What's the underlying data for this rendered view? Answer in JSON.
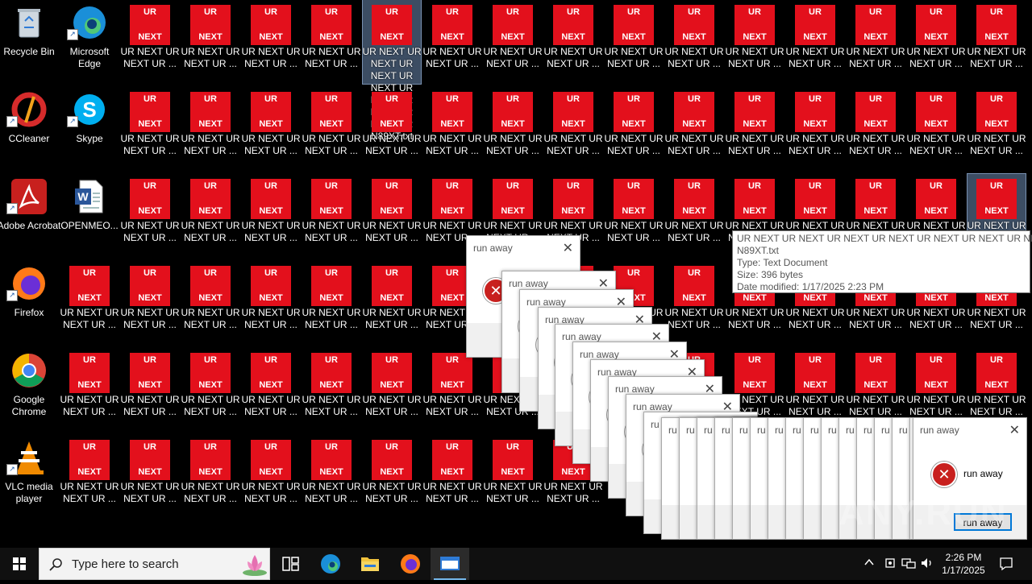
{
  "desktop": {
    "system_icons": [
      {
        "label": "Recycle Bin",
        "icon": "recycle-bin-icon"
      },
      {
        "label": "Microsoft Edge",
        "icon": "edge-icon"
      },
      {
        "label": "CCleaner",
        "icon": "ccleaner-icon"
      },
      {
        "label": "Skype",
        "icon": "skype-icon"
      },
      {
        "label": "Adobe Acrobat",
        "icon": "acrobat-icon"
      },
      {
        "label": "OPENMEO...",
        "icon": "word-doc-icon"
      },
      {
        "label": "Firefox",
        "icon": "firefox-icon"
      },
      {
        "label": "Google Chrome",
        "icon": "chrome-icon"
      },
      {
        "label": "VLC media player",
        "icon": "vlc-icon"
      }
    ],
    "tile_top_text": "UR",
    "tile_bottom_text": "NEXT",
    "file_label_line1": "UR NEXT UR",
    "file_label_line2": "NEXT UR ...",
    "selected_expanded_label": "UR NEXT UR NEXT UR NEXT UR NEXT UR NEXT UR NEXT UR NEXT UR N89XT.txt"
  },
  "tooltip": {
    "name_line1": "UR NEXT UR NEXT UR NEXT UR NEXT UR NEXT UR NEXT UR NEXT UR",
    "name_line2": "N89XT.txt",
    "type": "Type: Text Document",
    "size": "Size: 396 bytes",
    "modified": "Date modified: 1/17/2025 2:23 PM"
  },
  "dialogs": {
    "title": "run away",
    "message": "run away",
    "button": "run away",
    "close_glyph": "✕",
    "stub_title": "ru"
  },
  "taskbar": {
    "search_placeholder": "Type here to search",
    "time": "2:26 PM",
    "date": "1/17/2025"
  },
  "watermark": "ANY.RUN",
  "colors": {
    "tile_red": "#e3101c",
    "dialog_error_red": "#c8201e"
  }
}
